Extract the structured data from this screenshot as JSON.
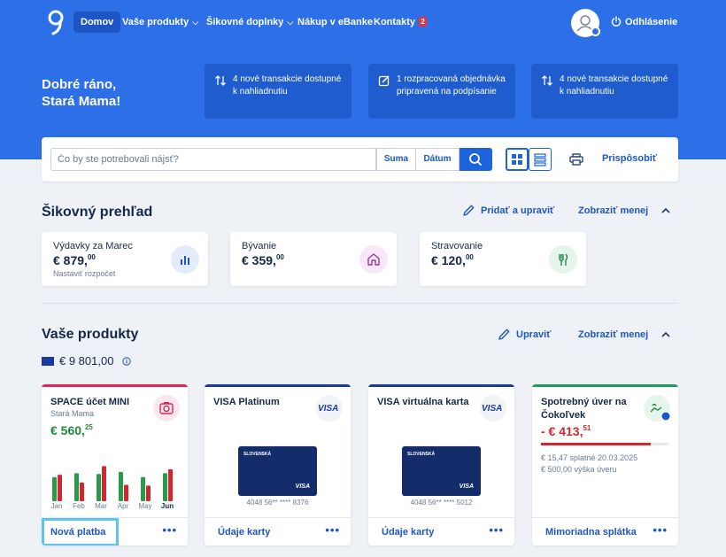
{
  "nav": {
    "items": [
      {
        "label": "Domov"
      },
      {
        "label": "Vaše produkty"
      },
      {
        "label": "Šikovné doplnky"
      },
      {
        "label": "Nákup v eBanke"
      },
      {
        "label": "Kontakty",
        "badge": "2"
      }
    ],
    "logout": "Odhlásenie"
  },
  "hero": {
    "greeting": "Dobré ráno,\nStará Mama!",
    "notices": [
      {
        "text": "4 nové transakcie dostupné k nahliadnutiu",
        "icon": "transfer-arrows-icon"
      },
      {
        "text": "1 rozpracovaná objednávka pripravená na podpísanie",
        "icon": "edit-document-icon"
      },
      {
        "text": "4 nové transakcie dostupné k nahliadnutiu",
        "icon": "transfer-arrows-icon"
      }
    ]
  },
  "search": {
    "placeholder": "Čo by ste potrebovali nájsť?",
    "sum_label": "Suma",
    "date_label": "Dátum",
    "customize_label": "Prispôsobiť"
  },
  "overview": {
    "title": "Šikovný prehľad",
    "add_edit": "Pridať a upraviť",
    "show_less": "Zobraziť menej",
    "cards": [
      {
        "label": "Výdavky za Marec",
        "amount": "€ 879,",
        "cents": "00",
        "sub": "Nastaviť rozpočet",
        "icon": "bar-chart-icon"
      },
      {
        "label": "Bývanie",
        "amount": "€ 359,",
        "cents": "00",
        "icon": "house-icon"
      },
      {
        "label": "Stravovanie",
        "amount": "€ 120,",
        "cents": "00",
        "icon": "dining-icon"
      }
    ]
  },
  "products": {
    "title": "Vaše produkty",
    "edit": "Upraviť",
    "show_less": "Zobraziť menej",
    "total": "€ 9 801,00",
    "cards": [
      {
        "title": "SPACE účet MINI",
        "owner": "Stará Mama",
        "amount": "€ 560,",
        "cents": "25",
        "action": "Nová platba",
        "accent": "#d9285a",
        "icon": "camera-icon",
        "months": [
          "Jan",
          "Feb",
          "Mar",
          "Apr",
          "May",
          "Jun"
        ]
      },
      {
        "title": "VISA Platinum",
        "brand": "VISA",
        "bank": "SLOVENSKÁ",
        "card_number": "4048 56** **** 8376",
        "action": "Údaje karty",
        "accent": "#1e3a8a"
      },
      {
        "title": "VISA virtuálna karta",
        "brand": "VISA",
        "bank": "SLOVENSKÁ",
        "card_number": "4048 56** **** 5012",
        "action": "Údaje karty",
        "accent": "#1e3a8a"
      },
      {
        "title": "Spotrebný úver na Čokoľvek",
        "amount": "- € 413,",
        "cents": "51",
        "action": "Mimoriadna splátka",
        "accent": "#1f9a5a",
        "icon": "loan-hand-icon",
        "line1": "€ 15,47 splatné 20.03.2025",
        "line2": "€ 500,00 výška úveru",
        "repaid_fraction": 0.86
      }
    ]
  },
  "chart_data": {
    "type": "bar",
    "categories": [
      "Jan",
      "Feb",
      "Mar",
      "Apr",
      "May",
      "Jun"
    ],
    "series": [
      {
        "values": [
          0.62,
          0.72,
          0.7,
          0.75,
          0.62,
          0.72
        ],
        "color": "#2a9a48"
      },
      {
        "values": [
          0.68,
          0.48,
          0.9,
          0.42,
          0.4,
          0.82
        ],
        "color": "#d0282e"
      }
    ],
    "ylim": [
      0,
      1
    ]
  }
}
